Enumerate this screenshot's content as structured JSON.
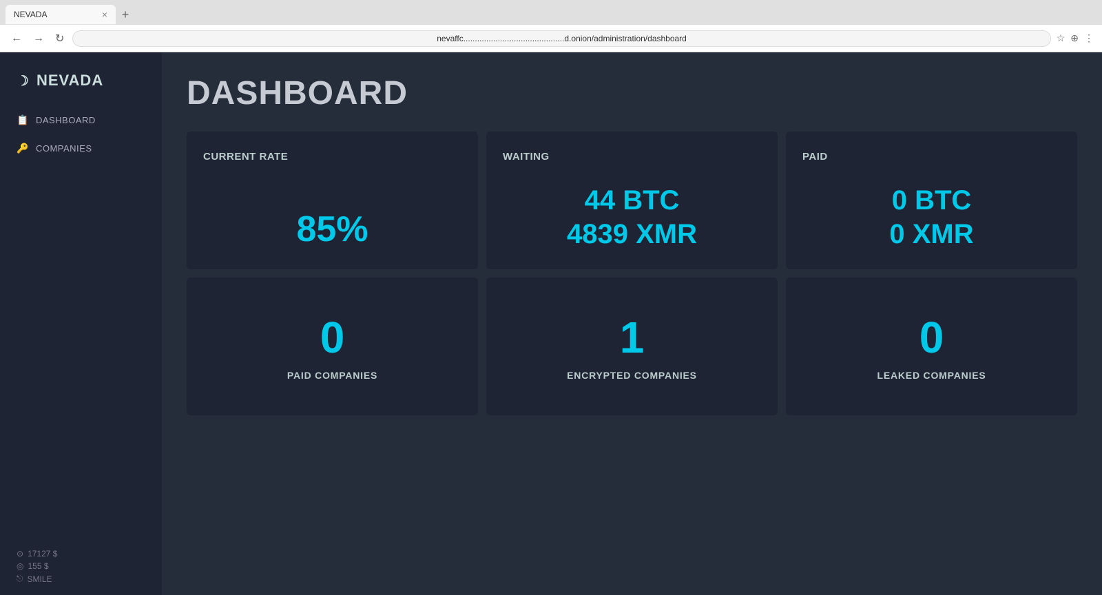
{
  "browser": {
    "tab_title": "NEVADA",
    "tab_close": "×",
    "tab_new": "+",
    "address": "nevaffc............................................d.onion/administration/dashboard",
    "nav_back": "←",
    "nav_forward": "→",
    "nav_refresh": "↻"
  },
  "sidebar": {
    "logo_icon": "☽",
    "logo_text": "NEVADA",
    "nav_items": [
      {
        "id": "dashboard",
        "icon": "📋",
        "label": "DASHBOARD"
      },
      {
        "id": "companies",
        "icon": "🔑",
        "label": "COMPANIES"
      }
    ],
    "footer": [
      {
        "icon": "⊙",
        "text": "17127 $"
      },
      {
        "icon": "◎",
        "text": "155 $"
      },
      {
        "icon": "⎋",
        "text": "SMILE"
      }
    ]
  },
  "main": {
    "page_title": "DASHBOARD",
    "cards_row1": [
      {
        "id": "current-rate",
        "label": "CURRENT RATE",
        "value": "85%"
      },
      {
        "id": "waiting",
        "label": "WAITING",
        "lines": [
          "44 BTC",
          "4839 XMR"
        ]
      },
      {
        "id": "paid",
        "label": "PAID",
        "lines": [
          "0 BTC",
          "0 XMR"
        ]
      }
    ],
    "cards_row2": [
      {
        "id": "paid-companies",
        "number": "0",
        "label": "PAID COMPANIES"
      },
      {
        "id": "encrypted-companies",
        "number": "1",
        "label": "ENCRYPTED COMPANIES"
      },
      {
        "id": "leaked-companies",
        "number": "0",
        "label": "LEAKED COMPANIES"
      }
    ]
  }
}
